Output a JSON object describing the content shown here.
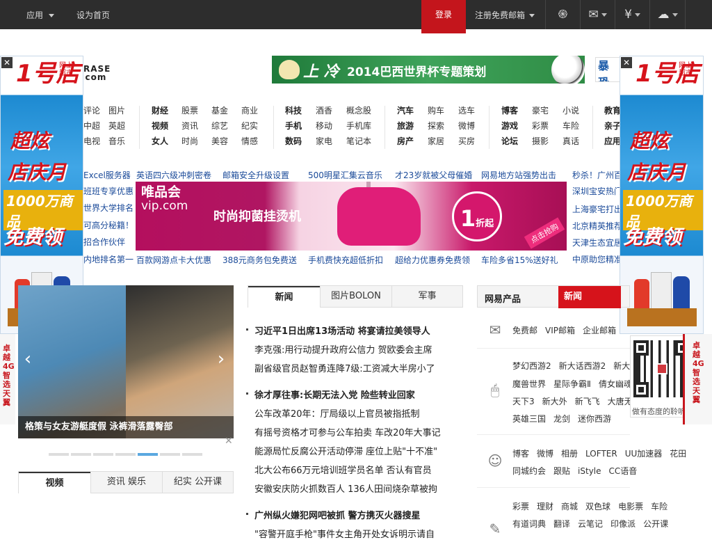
{
  "topbar": {
    "apps": "应用",
    "sethome": "设为首页",
    "login": "登录",
    "register": "注册免费邮箱"
  },
  "header": {
    "logo_tail_1": "RASE",
    "logo_tail_2": "com",
    "wc_banner_text": "2014巴西世界杯专题策划",
    "wc_banner_prefix": "上 冷",
    "right_banner": "暴恐"
  },
  "nav": {
    "col0": [
      [
        "评论",
        "图片"
      ],
      [
        "中超",
        "英超"
      ],
      [
        "电视",
        "音乐"
      ]
    ],
    "col1": [
      [
        "财经",
        "股票",
        "基金",
        "商业"
      ],
      [
        "视频",
        "资讯",
        "综艺",
        "纪实"
      ],
      [
        "女人",
        "时尚",
        "美容",
        "情感"
      ]
    ],
    "col2": [
      [
        "科技",
        "酒香",
        "概念股"
      ],
      [
        "手机",
        "移动",
        "手机库"
      ],
      [
        "数码",
        "家电",
        "笔记本"
      ]
    ],
    "col3": [
      [
        "汽车",
        "购车",
        "选车"
      ],
      [
        "旅游",
        "探索",
        "微博"
      ],
      [
        "房产",
        "家居",
        "买房"
      ]
    ],
    "col4": [
      [
        "博客",
        "豪宅",
        "小说"
      ],
      [
        "游戏",
        "彩票",
        "车险"
      ],
      [
        "论坛",
        "摄影",
        "真话"
      ]
    ],
    "col5": [
      [
        "教育"
      ],
      [
        "亲子"
      ],
      [
        "应用"
      ]
    ]
  },
  "links_top": [
    "Excel服务器",
    "英语四六级冲刺密卷",
    "邮箱安全升级设置",
    "500明星汇集云音乐",
    "才23岁就被父母催婚",
    "网易地方站强势出击",
    "秒杀！广州百"
  ],
  "links_left": [
    "班班专享优惠",
    "世界大学排名",
    "可高分秘籍！",
    "招合作伙伴",
    "内地排名第一"
  ],
  "links_right": [
    "深圳宝安热门",
    "上海豪宅打出",
    "北京精英推荐",
    "天津生态宜居",
    "中原助您精准"
  ],
  "links_bottom": [
    "百款网游点卡大优惠",
    "388元商务包免费送",
    "手机费快充超低折扣",
    "超给力优惠券免费领",
    "车险多省15%送好礼"
  ],
  "vip_ad": {
    "logo": "唯品会",
    "domain": "vip.com",
    "text": "时尚抑菌挂烫机",
    "circle_big": "1",
    "circle_small": "折起",
    "tag": "点击抢购"
  },
  "side_ad": {
    "brand": "1号店",
    "brand_small": "网上超市",
    "domain": "yhd.com",
    "line1": "超炫",
    "line2": "店庆月",
    "line3": "1000万商品",
    "line4": "免费领",
    "close": "✕"
  },
  "slideshow": {
    "caption": "格策与女友游艇度假 泳裤滑落露臀部"
  },
  "news_tabs": [
    "新闻",
    "图片BOLON",
    "军事"
  ],
  "news": [
    {
      "text": "习近平1日出席13场活动 将宴请拉美领导人",
      "bold": true
    },
    {
      "text": "李克强:用行动提升政府公信力 贺欧委会主席",
      "bold": false
    },
    {
      "text": "副省级官员赵智勇连降7级:工资减大半房小了",
      "bold": false
    },
    {
      "text": "徐才厚往事:长期无法入党 险些转业回家",
      "bold": true
    },
    {
      "text": "公车改革20年：厅局级以上官员被指抵制",
      "bold": false
    },
    {
      "text": "有摇号资格才可参与公车拍卖  车改20年大事记",
      "bold": false
    },
    {
      "text": "能源局忙反腐公开活动停滞 座位上贴\"十不准\"",
      "bold": false
    },
    {
      "text": "北大公布66万元培训班学员名单 否认有官员",
      "bold": false
    },
    {
      "text": "安徽安庆防火抓数百人 136人田间烧杂草被拘",
      "bold": false
    },
    {
      "text": "广州纵火嫌犯网吧被抓 警方携灭火器搜星",
      "bold": true
    },
    {
      "text": "\"容警开庭手枪\"事件女主角开处女诉明示请自",
      "bold": false
    }
  ],
  "video_tabs": [
    "视频",
    "资讯  娱乐",
    "纪实  公开课"
  ],
  "right_panel": {
    "title": "网易产品",
    "tag": "新闻",
    "rows": [
      [
        "免费邮",
        "VIP邮箱",
        "企业邮箱"
      ],
      [
        "梦幻西游2",
        "新大话西游2",
        "新大"
      ],
      [
        "魔兽世界",
        "星际争霸Ⅱ",
        "倩女幽魂"
      ],
      [
        "天下3",
        "新大外",
        "新飞飞",
        "大唐无"
      ],
      [
        "英雄三国",
        "龙剑",
        "迷你西游"
      ],
      [
        "博客",
        "微博",
        "相册",
        "LOFTER",
        "UU加速器",
        "花田"
      ],
      [
        "同城约会",
        "跟贴",
        "iStyle",
        "CC语音"
      ],
      [
        "彩票",
        "理财",
        "商城",
        "双色球",
        "电影票",
        "车险"
      ],
      [
        "有道词典",
        "翻译",
        "云笔记",
        "印像派",
        "公开课"
      ]
    ]
  },
  "qr": {
    "caption": "做有态度的聆听者",
    "strip_right": "卓越4G 智选天翼",
    "strip_left": "卓越4G 智选天翼"
  }
}
